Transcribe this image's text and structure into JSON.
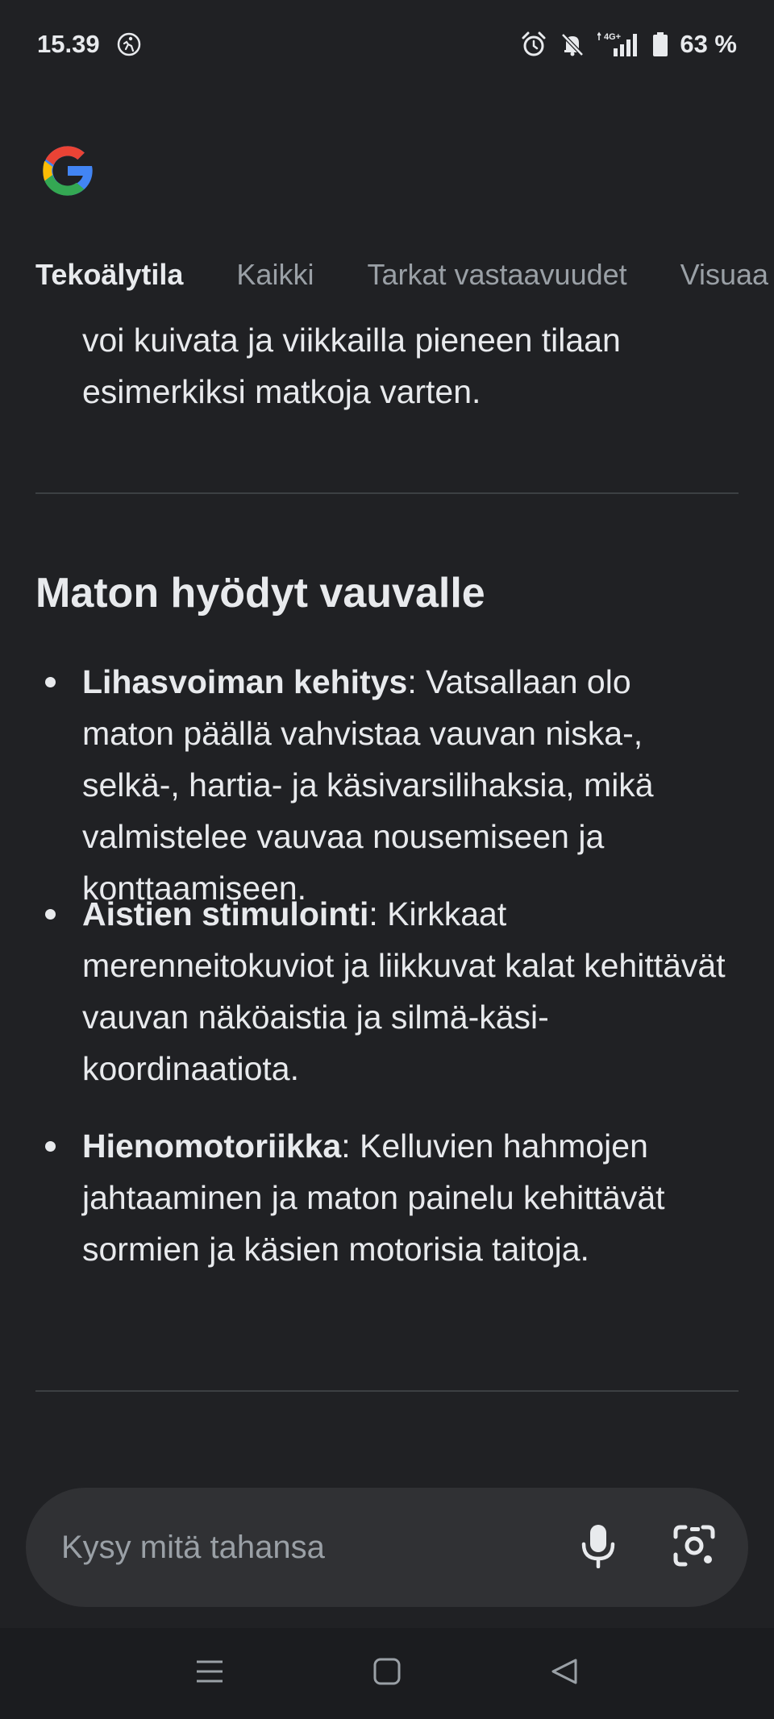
{
  "status_bar": {
    "time": "15.39",
    "network": "4G+",
    "battery": "63 %"
  },
  "tabs": [
    {
      "label": "Tekoälytila",
      "active": true
    },
    {
      "label": "Kaikki",
      "active": false
    },
    {
      "label": "Tarkat vastaavuudet",
      "active": false
    },
    {
      "label": "Visuaa",
      "active": false
    }
  ],
  "content": {
    "intro_paragraph": "voi kuivata ja viikkailla pieneen tilaan esimerkiksi matkoja varten.",
    "section_heading": "Maton hyödyt vauvalle",
    "bullets": [
      {
        "title": "Lihasvoiman kehitys",
        "text": ": Vatsallaan olo maton päällä vahvistaa vauvan niska-, selkä-, hartia- ja käsivarsilihaksia, mikä valmistelee vauvaa nousemiseen ja konttaamiseen."
      },
      {
        "title": "Aistien stimulointi",
        "text": ": Kirkkaat merenneitokuviot ja liikkuvat kalat kehittävät vauvan näköaistia ja silmä-käsi-koordinaatiota."
      },
      {
        "title": "Hienomotoriikka",
        "text": ": Kelluvien hahmojen jahtaaminen ja maton painelu kehittävät sormien ja käsien motorisia taitoja."
      }
    ]
  },
  "search": {
    "placeholder": "Kysy mitä tahansa"
  },
  "colors": {
    "background": "#202124",
    "text": "#e8eaed",
    "muted": "#9aa0a6",
    "search_bg": "#303134"
  }
}
